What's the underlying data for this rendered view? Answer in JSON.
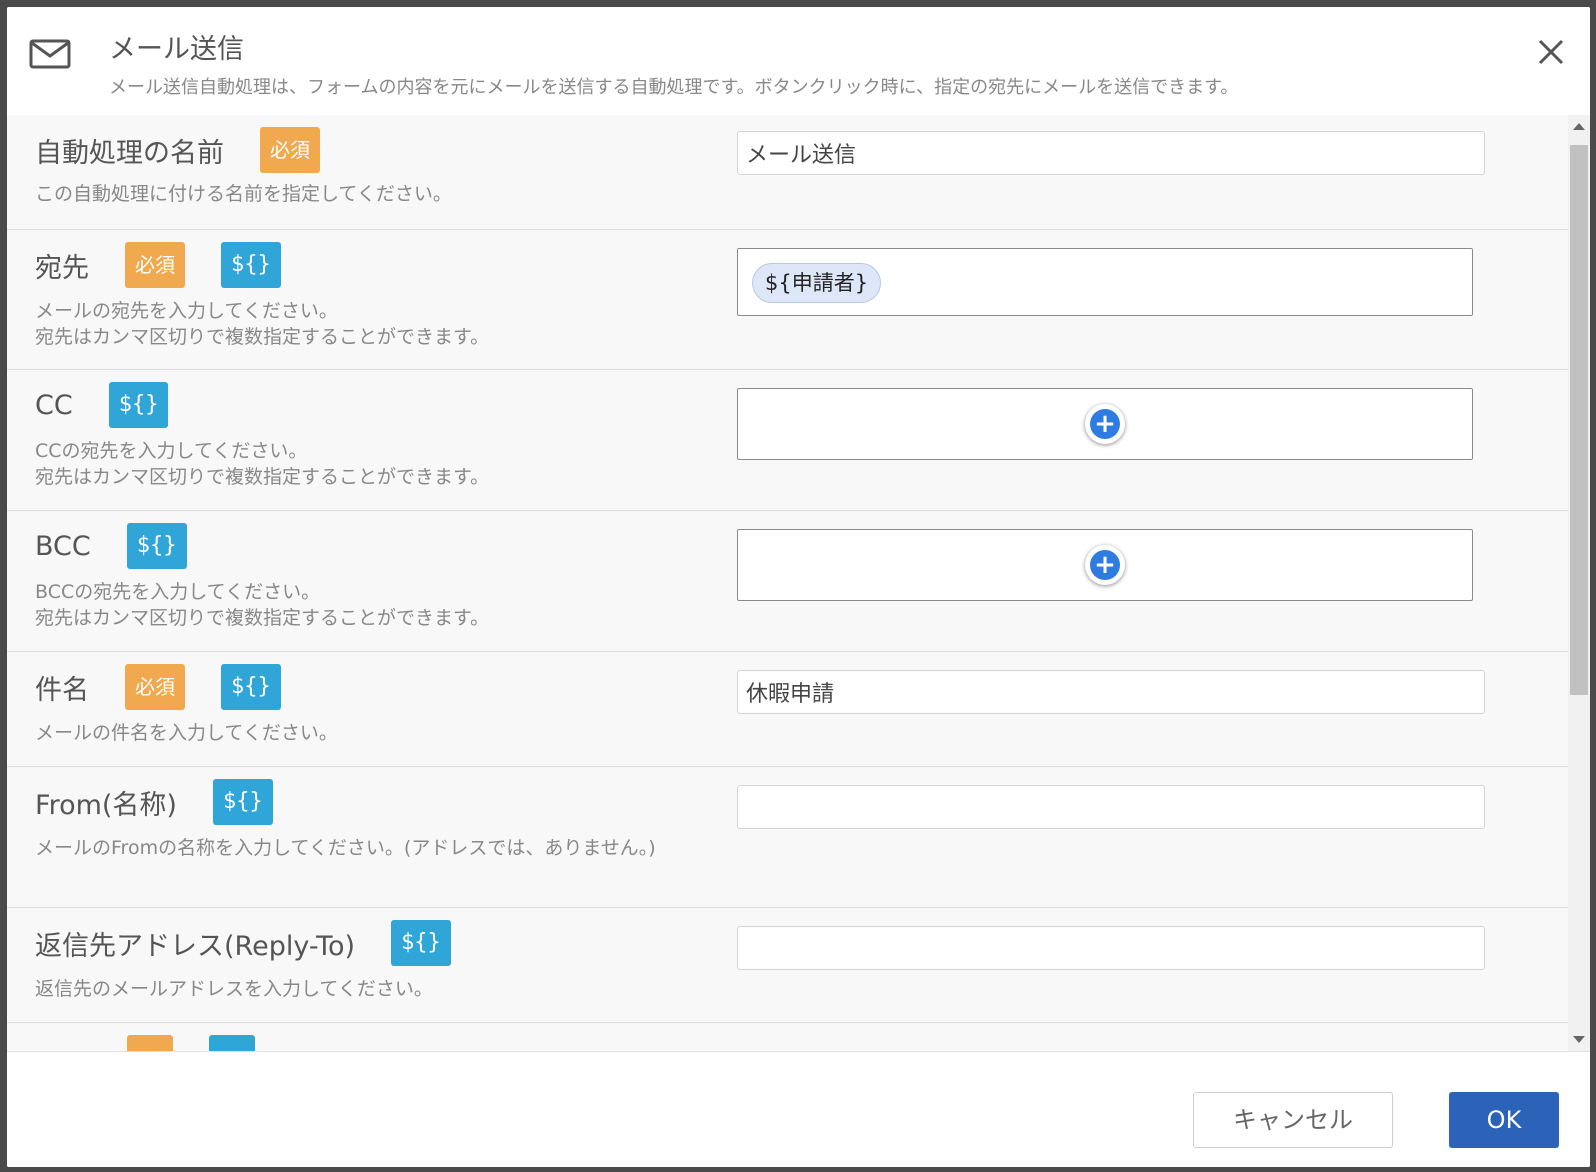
{
  "dialog": {
    "title": "メール送信",
    "subtitle": "メール送信自動処理は、フォームの内容を元にメールを送信する自動処理です。ボタンクリック時に、指定の宛先にメールを送信できます。",
    "icon": "mail-icon",
    "close_icon": "close-icon"
  },
  "badges": {
    "required": "必須",
    "variable": "${}"
  },
  "rows": {
    "name": {
      "label": "自動処理の名前",
      "desc": "この自動処理に付ける名前を指定してください。",
      "value": "メール送信"
    },
    "to": {
      "label": "宛先",
      "desc1": "メールの宛先を入力してください。",
      "desc2": "宛先はカンマ区切りで複数指定することができます。",
      "chip": "${申請者}"
    },
    "cc": {
      "label": "CC",
      "desc1": "CCの宛先を入力してください。",
      "desc2": "宛先はカンマ区切りで複数指定することができます。"
    },
    "bcc": {
      "label": "BCC",
      "desc1": "BCCの宛先を入力してください。",
      "desc2": "宛先はカンマ区切りで複数指定することができます。"
    },
    "subject": {
      "label": "件名",
      "desc": "メールの件名を入力してください。",
      "value": "休暇申請"
    },
    "from_name": {
      "label": "From(名称)",
      "desc": "メールのFromの名称を入力してください。(アドレスでは、ありません。)",
      "value": ""
    },
    "reply_to": {
      "label": "返信先アドレス(Reply-To)",
      "desc": "返信先のメールアドレスを入力してください。",
      "value": ""
    }
  },
  "footer": {
    "cancel": "キャンセル",
    "ok": "OK"
  },
  "colors": {
    "required": "#f0a94e",
    "variable": "#2fa5d8",
    "ok": "#2c62b8",
    "plus": "#2e7ce0"
  }
}
